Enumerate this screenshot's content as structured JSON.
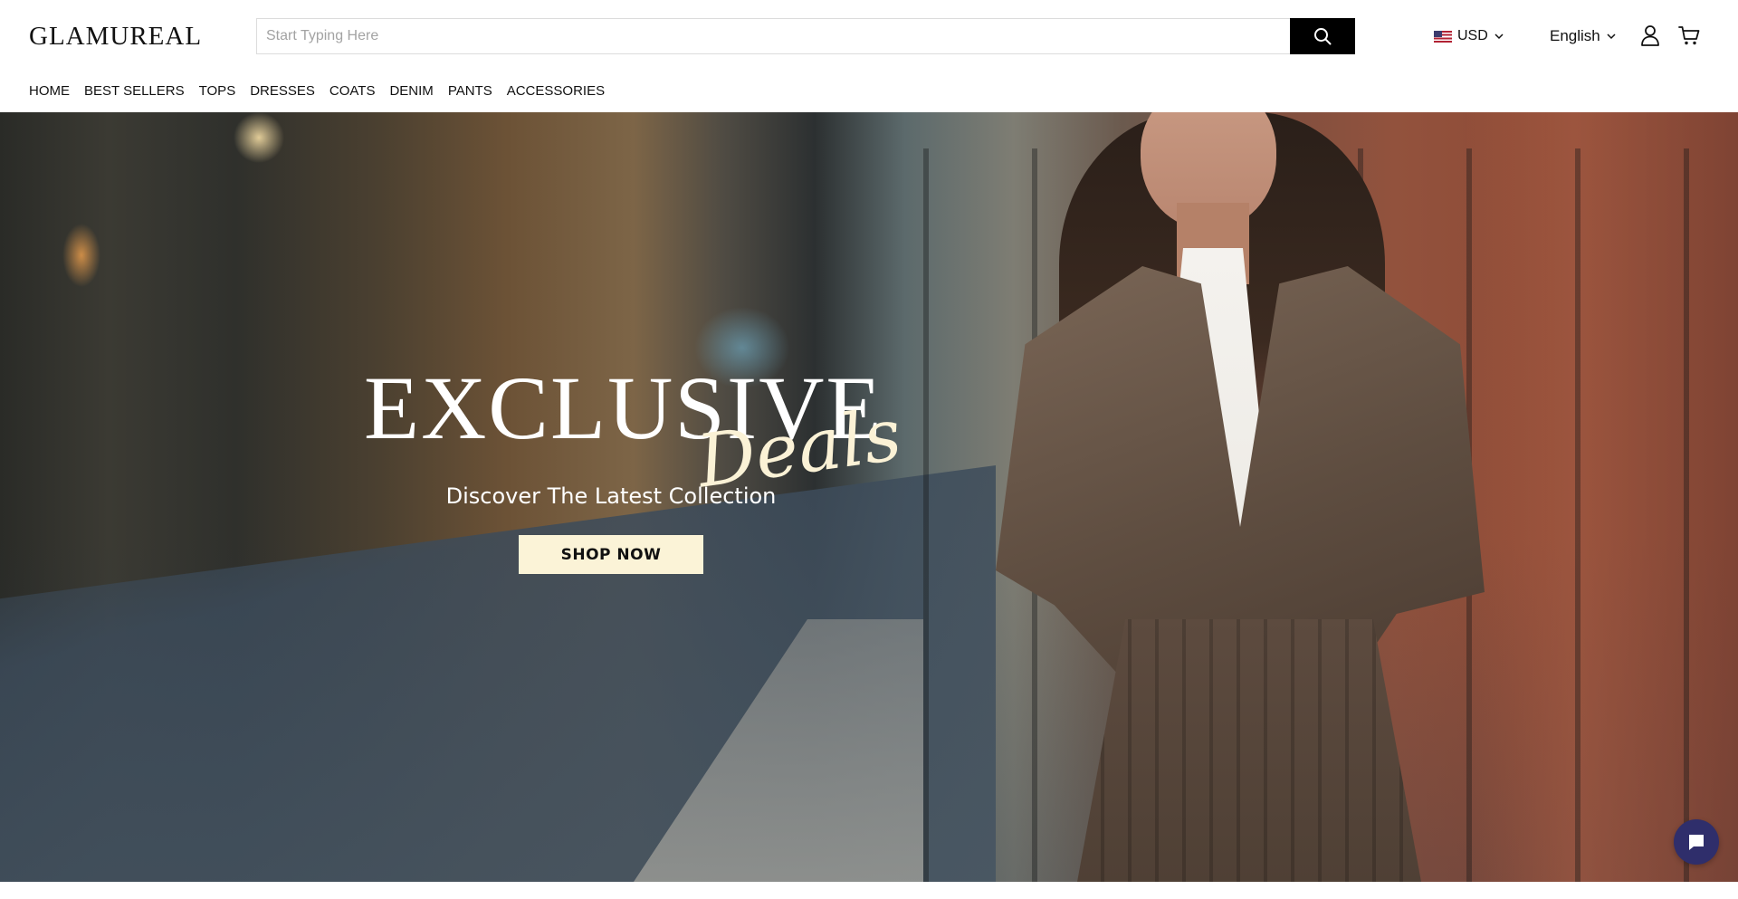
{
  "header": {
    "logo_text": "GLAMUREAL",
    "search": {
      "placeholder": "Start Typing Here",
      "value": ""
    },
    "icons": {
      "search": "search-icon",
      "account": "user-icon",
      "cart": "cart-icon",
      "chevron": "chevron-down-icon"
    },
    "currency": {
      "flag": "us-flag-icon",
      "label": "USD"
    },
    "language": {
      "label": "English"
    }
  },
  "nav": {
    "items": [
      {
        "label": "HOME"
      },
      {
        "label": "BEST SELLERS"
      },
      {
        "label": "TOPS"
      },
      {
        "label": "DRESSES"
      },
      {
        "label": "COATS"
      },
      {
        "label": "DENIM"
      },
      {
        "label": "PANTS"
      },
      {
        "label": "ACCESSORIES"
      }
    ]
  },
  "hero": {
    "title": "EXCLUSIVE",
    "script": "Deals",
    "subtitle": "Discover The Latest Collection",
    "cta_label": "SHOP NOW",
    "cta_bg": "#fbf3d7"
  },
  "chat": {
    "icon": "chat-bubble-icon",
    "color": "#2f2e6b"
  }
}
